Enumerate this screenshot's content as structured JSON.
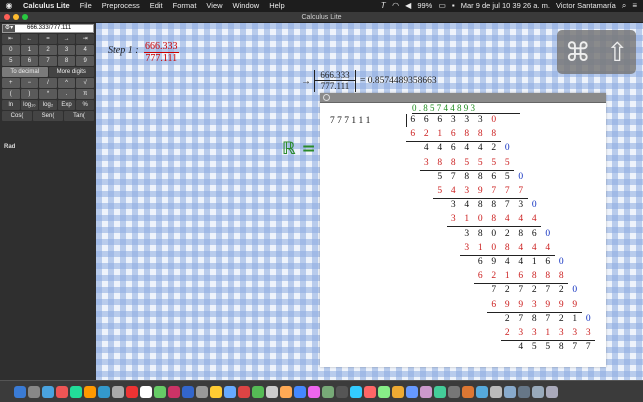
{
  "menubar": {
    "apple": "",
    "app_name": "Calculus Lite",
    "items": [
      "File",
      "Preprocess",
      "Edit",
      "Format",
      "View",
      "Window",
      "Help"
    ],
    "status": {
      "battery": "99%",
      "clock": "Mar 9 de jul  10 39 26 a. m.",
      "user": "Victor Santamaría"
    }
  },
  "window": {
    "title": "Calculus Lite"
  },
  "panel": {
    "expression": "666.333/777.111",
    "keys": [
      [
        "⇤",
        "←",
        "=",
        "→",
        "⇥"
      ],
      [
        "0",
        "1",
        "2",
        "3",
        "4"
      ],
      [
        "5",
        "6",
        "7",
        "8",
        "9"
      ],
      [
        "To decimal",
        "More digits"
      ],
      [
        "+",
        "−",
        "/",
        "^",
        "√"
      ],
      [
        "(",
        ")",
        "*",
        ".",
        "π"
      ],
      [
        "ln",
        "log₁₀",
        "log₂",
        "Exp",
        "%"
      ],
      [
        "Cos(",
        "Sen(",
        "Tan("
      ]
    ],
    "angle_mode": "Rad"
  },
  "main": {
    "step_label": "Step 1 :",
    "fraction": {
      "num": "666.333",
      "den": "777.111"
    },
    "arrow": "→",
    "fraction2": {
      "num": "666.333",
      "den": "777.111"
    },
    "result": "= 0.8574489358663",
    "reals_symbol": "ℝ =",
    "minus": "–"
  },
  "division": {
    "quotient": "0 . 8 5 7 4 4 8 9 3",
    "divisor": "7 7 7 1 1 1",
    "rows": [
      {
        "d": [
          "6",
          "6",
          "6",
          "3",
          "3",
          "3",
          "0"
        ],
        "s": 0,
        "t": "b",
        "last_red": true
      },
      {
        "d": [
          "6",
          "2",
          "1",
          "6",
          "8",
          "8",
          "8"
        ],
        "s": 0,
        "t": "r"
      },
      {
        "d": [
          "4",
          "4",
          "6",
          "4",
          "4",
          "2",
          "0"
        ],
        "s": 1,
        "t": "b",
        "last_blue": true
      },
      {
        "d": [
          "3",
          "8",
          "8",
          "5",
          "5",
          "5",
          "5"
        ],
        "s": 1,
        "t": "r"
      },
      {
        "d": [
          "5",
          "7",
          "8",
          "8",
          "6",
          "5",
          "0"
        ],
        "s": 2,
        "t": "b",
        "last_blue": true
      },
      {
        "d": [
          "5",
          "4",
          "3",
          "9",
          "7",
          "7",
          "7"
        ],
        "s": 2,
        "t": "r"
      },
      {
        "d": [
          "3",
          "4",
          "8",
          "8",
          "7",
          "3",
          "0"
        ],
        "s": 3,
        "t": "b",
        "last_blue": true
      },
      {
        "d": [
          "3",
          "1",
          "0",
          "8",
          "4",
          "4",
          "4"
        ],
        "s": 3,
        "t": "r"
      },
      {
        "d": [
          "3",
          "8",
          "0",
          "2",
          "8",
          "6",
          "0"
        ],
        "s": 4,
        "t": "b",
        "last_blue": true
      },
      {
        "d": [
          "3",
          "1",
          "0",
          "8",
          "4",
          "4",
          "4"
        ],
        "s": 4,
        "t": "r"
      },
      {
        "d": [
          "6",
          "9",
          "4",
          "4",
          "1",
          "6",
          "0"
        ],
        "s": 5,
        "t": "b",
        "last_blue": true
      },
      {
        "d": [
          "6",
          "2",
          "1",
          "6",
          "8",
          "8",
          "8"
        ],
        "s": 5,
        "t": "r"
      },
      {
        "d": [
          "7",
          "2",
          "7",
          "2",
          "7",
          "2",
          "0"
        ],
        "s": 6,
        "t": "b",
        "last_blue": true
      },
      {
        "d": [
          "6",
          "9",
          "9",
          "3",
          "9",
          "9",
          "9"
        ],
        "s": 6,
        "t": "r"
      },
      {
        "d": [
          "2",
          "7",
          "8",
          "7",
          "2",
          "1",
          "0"
        ],
        "s": 7,
        "t": "b",
        "last_blue": true
      },
      {
        "d": [
          "2",
          "3",
          "3",
          "1",
          "3",
          "3",
          "3"
        ],
        "s": 7,
        "t": "r"
      },
      {
        "d": [
          "4",
          "5",
          "5",
          "8",
          "7",
          "7"
        ],
        "s": 8,
        "t": "b"
      }
    ]
  },
  "overlay": {
    "cmd_icon": "⌘",
    "shift_icon": "⇧"
  },
  "colors": {
    "accent_green": "#1a8a1a",
    "red": "#cc2020",
    "blue": "#1030c0"
  }
}
